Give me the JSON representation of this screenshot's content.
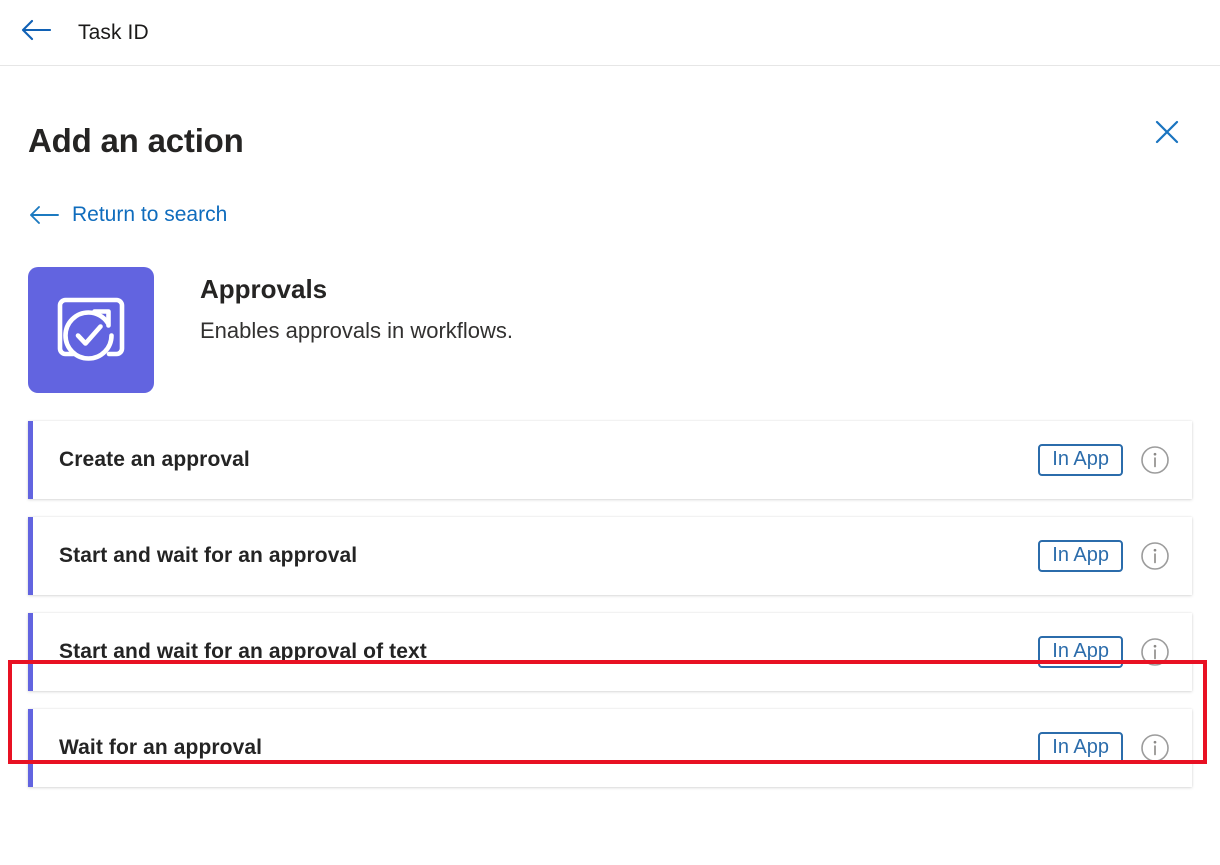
{
  "topbar": {
    "back_icon": "arrow-left-icon",
    "title": "Task ID"
  },
  "panel": {
    "title": "Add an action",
    "close_icon": "close-icon",
    "return_icon": "arrow-left-icon",
    "return_label": "Return to search"
  },
  "connector": {
    "icon": "approvals-icon",
    "name": "Approvals",
    "description": "Enables approvals in workflows."
  },
  "actions": [
    {
      "label": "Create an approval",
      "badge": "In App",
      "info_icon": "info-circle-icon"
    },
    {
      "label": "Start and wait for an approval",
      "badge": "In App",
      "info_icon": "info-circle-icon"
    },
    {
      "label": "Start and wait for an approval of text",
      "badge": "In App",
      "info_icon": "info-circle-icon"
    },
    {
      "label": "Wait for an approval",
      "badge": "In App",
      "info_icon": "info-circle-icon"
    }
  ],
  "highlight": {
    "target_label": "Start and wait for an approval of text",
    "color": "#e81123"
  },
  "colors": {
    "accent_purple": "#6264e0",
    "link_blue": "#0f6cbd",
    "badge_blue": "#2b6cab",
    "highlight_red": "#e81123",
    "text_dark": "#252423"
  }
}
